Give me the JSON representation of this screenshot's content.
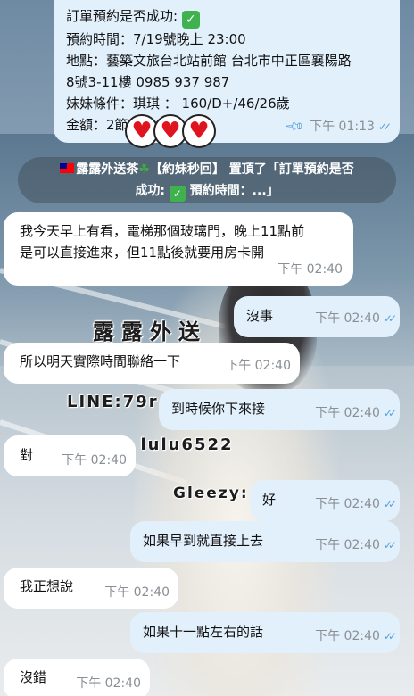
{
  "background": {
    "watermark_title": "露露外送",
    "watermark_line": "LINE:79r",
    "watermark_lulu": ": lulu6522",
    "watermark_gleezy": "Gleezy:"
  },
  "order_message": {
    "line1": "訂單預約是否成功:",
    "line2": "預約時間：7/19號晚上 23:00",
    "line3": "地點：藝築文旅台北站前館 台北市中正區襄陽路",
    "line4": "8號3-11樓 0985 937 987",
    "line5": "妹妹條件：琪琪 ： 160/D+/46/26歲",
    "line6": "金額：2節",
    "time": "下午 01:13",
    "check_icon": "white-heavy-check-mark",
    "pin_icon": "pushpin"
  },
  "heart_stickers": [
    "heart",
    "heart",
    "heart"
  ],
  "pinned_notice": {
    "sender": "露露外送茶",
    "tag": "【約妹秒回】",
    "action": "置頂了「訂單預約是否",
    "line2_a": "成功:",
    "line2_b": "預約時間：...」"
  },
  "messages": [
    {
      "dir": "in",
      "text_line1": "我今天早上有看，電梯那個玻璃門，晚上11點前",
      "text_line2": "是可以直接進來，但11點後就要用房卡開",
      "time": "下午 02:40"
    },
    {
      "dir": "out",
      "text": "沒事",
      "time": "下午 02:40"
    },
    {
      "dir": "in",
      "text": "所以明天實際時間聯絡一下",
      "time": "下午 02:40"
    },
    {
      "dir": "out",
      "text": "到時候你下來接",
      "time": "下午 02:40"
    },
    {
      "dir": "in",
      "text": "對",
      "time": "下午 02:40"
    },
    {
      "dir": "out",
      "text": "好",
      "time": "下午 02:40"
    },
    {
      "dir": "out",
      "text": "如果早到就直接上去",
      "time": "下午 02:40"
    },
    {
      "dir": "in",
      "text": "我正想說",
      "time": "下午 02:40"
    },
    {
      "dir": "out",
      "text": "如果十一點左右的話",
      "time": "下午 02:40"
    },
    {
      "dir": "in",
      "text": "沒錯",
      "time": "下午 02:40"
    }
  ],
  "colors": {
    "incoming_bubble": "#ffffff",
    "outgoing_bubble": "#e2f0fc",
    "read_ticks": "#5aa0d8"
  }
}
